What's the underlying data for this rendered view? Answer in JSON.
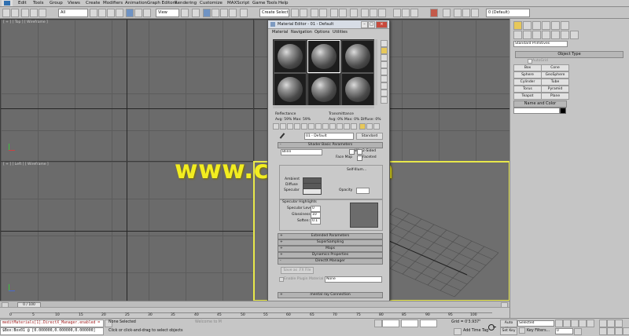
{
  "menu": [
    "Edit",
    "Tools",
    "Group",
    "Views",
    "Create",
    "Modifiers",
    "Animation",
    "Graph Editors",
    "Rendering",
    "Customize",
    "MAXScript",
    "Game Tools",
    "Help"
  ],
  "toolbar": {
    "filter": "All",
    "view": "View",
    "selection_set": "Create Selection Se",
    "layer": "0 (Default)"
  },
  "viewports": {
    "top": "[ + ] [ Top ] [ Wireframe ]",
    "left": "[ + ] [ Left ] [ Wireframe ]"
  },
  "command_panel": {
    "category": "Standard Primitives",
    "object_type_title": "Object Type",
    "autogrid": "AutoGrid",
    "buttons": [
      "Box",
      "Cone",
      "Sphere",
      "GeoSphere",
      "Cylinder",
      "Tube",
      "Torus",
      "Pyramid",
      "Teapot",
      "Plane"
    ],
    "name_color_title": "Name and Color"
  },
  "material_editor": {
    "title": "Material Editor - 01 - Default",
    "menu": [
      "Material",
      "Navigation",
      "Options",
      "Utilities"
    ],
    "reflectance_label": "Reflectance",
    "reflectance_values": "Avg:  59% Max:  59%",
    "transmittance_label": "Transmittance",
    "transmittance_values": "Avg:  0% Max:  0%  Diffuse:  0%",
    "material_name": "01 - Default",
    "material_type": "Standard",
    "shader_basic_title": "Shader Basic Parameters",
    "shader": "Blinn",
    "wire": "Wire",
    "two_sided": "2-Sided",
    "face_map": "Face Map",
    "faceted": "Faceted",
    "self_illum_title": "Self-Illum...",
    "ambient": "Ambient",
    "diffuse": "Diffuse",
    "specular": "Specular",
    "opacity": "Opacity",
    "specular_highlights_title": "Specular Highlights",
    "specular_level_label": "Specular Level:",
    "specular_level": "0",
    "glossiness_label": "Glossiness:",
    "glossiness": "10",
    "soften_label": "Soften:",
    "soften": "0.1",
    "rollouts": [
      "Extended Parameters",
      "SuperSampling",
      "Maps",
      "Dynamics Properties",
      "DirectX Manager"
    ],
    "save_fx": "Save as .FX File",
    "enable_plugin": "Enable Plugin Material",
    "plugin_value": "None",
    "mental_ray": "mental ray Connection"
  },
  "watermark": "www.cgtsj.com",
  "timeline": {
    "frame": "0 / 100",
    "ticks": [
      "0",
      "5",
      "10",
      "15",
      "20",
      "25",
      "30",
      "35",
      "40",
      "45",
      "50",
      "55",
      "60",
      "65",
      "70",
      "75",
      "80",
      "85",
      "90",
      "95",
      "100"
    ]
  },
  "status": {
    "script_line1": "meditMaterials[1].DirectX_Manager.enabled =",
    "script_line2": "$Box:Box01 @ [0.000000,0.000000,0.000000]",
    "selection": "None Selected",
    "prompt": "Click or click-and-drag to select objects",
    "welcome": "Welcome to M",
    "grid": "Grid = 0'3.937\"",
    "auto_key": "Auto Key",
    "set_key": "Set Key",
    "key_mode": "Selected",
    "key_filters": "Key Filters...",
    "add_time_tag": "Add Time Tag",
    "frame_number": "0"
  },
  "colors": {
    "watermark": "#f2ed20",
    "active_viewport": "#e8e84a",
    "viewport_bg": "#6b6b6b"
  }
}
